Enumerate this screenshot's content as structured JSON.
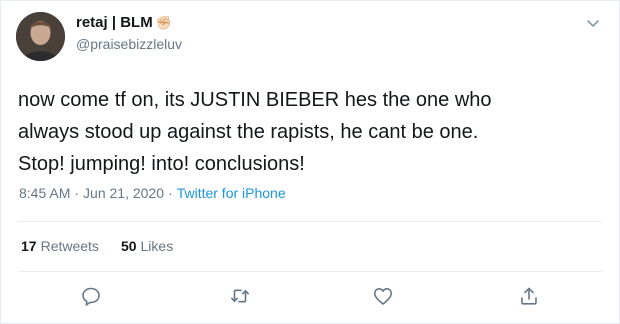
{
  "user": {
    "display_name": "retaj | BLM",
    "handle": "@praisebizzleluv",
    "emoji": "✊🏻"
  },
  "tweet": {
    "text": "now come tf on, its JUSTIN BIEBER hes the one who\nalways stood up against the rapists, he cant be one.\nStop! jumping! into! conclusions!",
    "time": "8:45 AM",
    "separator": "·",
    "date": "Jun 21, 2020",
    "source": "Twitter for iPhone"
  },
  "stats": {
    "retweets_count": "17",
    "retweets_label": "Retweets",
    "likes_count": "50",
    "likes_label": "Likes"
  },
  "icons": {
    "menu": "chevron-down-icon",
    "reply": "reply-icon",
    "retweet": "retweet-icon",
    "like": "heart-icon",
    "share": "share-icon"
  },
  "colors": {
    "text": "#14171a",
    "muted": "#657786",
    "link": "#1b95e0",
    "border": "#e6ecf0"
  }
}
